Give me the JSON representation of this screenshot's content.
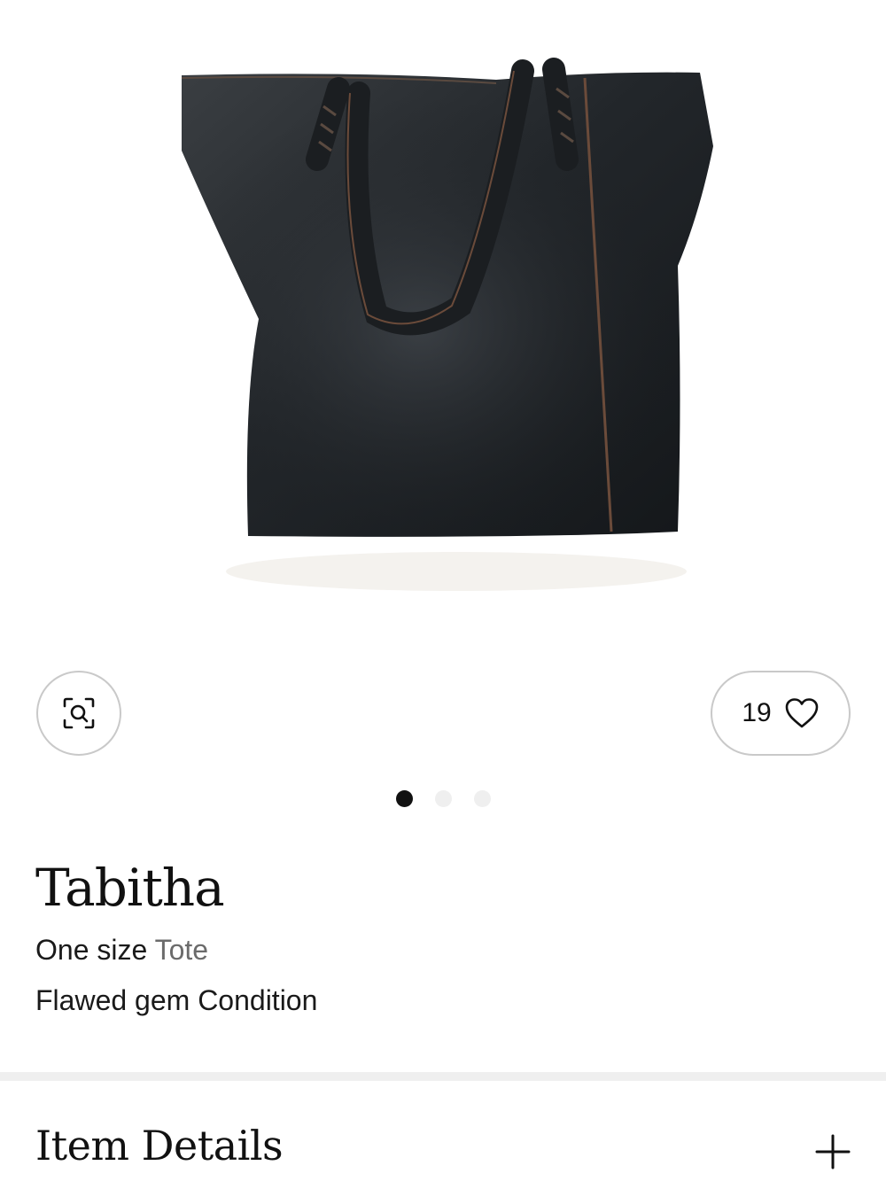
{
  "product": {
    "brand": "Tabitha",
    "size": "One size",
    "category": "Tote",
    "condition": "Flawed gem Condition"
  },
  "favorites": {
    "count": "19"
  },
  "carousel": {
    "total": 3,
    "active_index": 0
  },
  "sections": {
    "item_details": "Item Details"
  },
  "icons": {
    "search": "image-search-icon",
    "favorite": "heart-icon",
    "expand": "plus-icon"
  },
  "colors": {
    "active_dot": "#111111",
    "inactive_dot": "#efefef",
    "border": "#c9c9c9"
  }
}
